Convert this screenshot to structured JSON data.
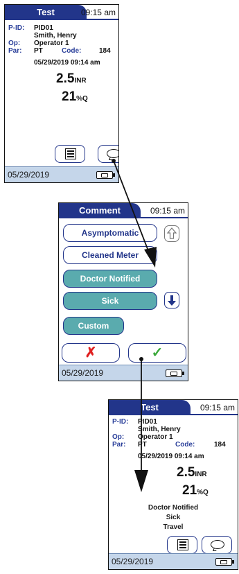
{
  "screen1": {
    "title": "Test",
    "time": "09:15 am",
    "labels": {
      "pid": "P-ID:",
      "op": "Op:",
      "par": "Par:",
      "code": "Code:"
    },
    "pid": "PID01",
    "name": "Smith, Henry",
    "operator": "Operator 1",
    "par": "PT",
    "code": "184",
    "datetime": "05/29/2019 09:14 am",
    "inr_value": "2.5",
    "inr_unit": "INR",
    "q_value": "21",
    "q_unit": "%Q",
    "footer_date": "05/29/2019"
  },
  "screen2": {
    "title": "Comment",
    "time": "09:15 am",
    "options": [
      {
        "label": "Asymptomatic",
        "selected": false
      },
      {
        "label": "Cleaned Meter",
        "selected": false
      },
      {
        "label": "Doctor Notified",
        "selected": true
      },
      {
        "label": "Sick",
        "selected": true
      },
      {
        "label": "Custom",
        "selected": true
      }
    ],
    "cancel_symbol": "✗",
    "confirm_symbol": "✓",
    "footer_date": "05/29/2019"
  },
  "screen3": {
    "title": "Test",
    "time": "09:15 am",
    "labels": {
      "pid": "P-ID:",
      "op": "Op:",
      "par": "Par:",
      "code": "Code:"
    },
    "pid": "PID01",
    "name": "Smith, Henry",
    "operator": "Operator 1",
    "par": "PT",
    "code": "184",
    "datetime": "05/29/2019 09:14 am",
    "inr_value": "2.5",
    "inr_unit": "INR",
    "q_value": "21",
    "q_unit": "%Q",
    "comments": [
      "Doctor Notified",
      "Sick",
      "Travel"
    ],
    "footer_date": "05/29/2019"
  },
  "colors": {
    "title_bar": "#22358a",
    "selected_option": "#5aabae",
    "footer": "#c5d6ea",
    "cancel": "#e02020",
    "confirm": "#3aa83a"
  },
  "icons": [
    "list-icon",
    "comment-bubble-icon",
    "up-arrow-icon",
    "down-arrow-icon",
    "battery-icon",
    "cancel-x-icon",
    "confirm-check-icon"
  ]
}
